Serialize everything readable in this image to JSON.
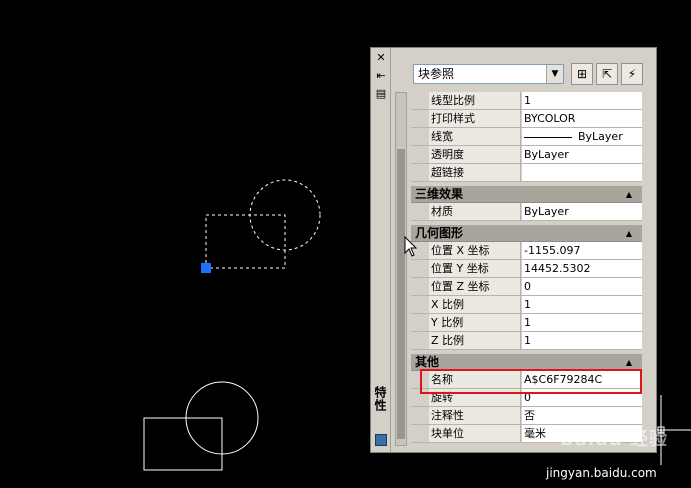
{
  "palette": {
    "side_title": "特性",
    "object_type": "块参照",
    "side_icons": [
      "close-icon",
      "autohide-icon",
      "properties-menu-icon"
    ]
  },
  "rows": [
    {
      "key": "线型比例",
      "value": "1"
    },
    {
      "key": "打印样式",
      "value": "BYCOLOR"
    },
    {
      "key": "线宽",
      "value": "ByLayer"
    },
    {
      "key": "透明度",
      "value": "ByLayer"
    },
    {
      "key": "超链接",
      "value": ""
    }
  ],
  "cat_3d": {
    "title": "三维效果",
    "rows": [
      {
        "key": "材质",
        "value": "ByLayer"
      }
    ]
  },
  "cat_geom": {
    "title": "几何图形",
    "rows": [
      {
        "key": "位置 X 坐标",
        "value": "-1155.097"
      },
      {
        "key": "位置 Y 坐标",
        "value": "14452.5302"
      },
      {
        "key": "位置 Z 坐标",
        "value": "0"
      },
      {
        "key": "X 比例",
        "value": "1"
      },
      {
        "key": "Y 比例",
        "value": "1"
      },
      {
        "key": "Z 比例",
        "value": "1"
      }
    ]
  },
  "cat_misc": {
    "title": "其他",
    "rows": [
      {
        "key": "名称",
        "value": "A$C6F79284C"
      },
      {
        "key": "旋转",
        "value": "0"
      },
      {
        "key": "注释性",
        "value": "否"
      },
      {
        "key": "块单位",
        "value": "毫米"
      }
    ]
  },
  "watermark": "Baidu 经验",
  "url": "jingyan.baidu.com",
  "colors": {
    "highlight": "#e0121a",
    "grip": "#1e6fff",
    "canvas": "#000000"
  }
}
